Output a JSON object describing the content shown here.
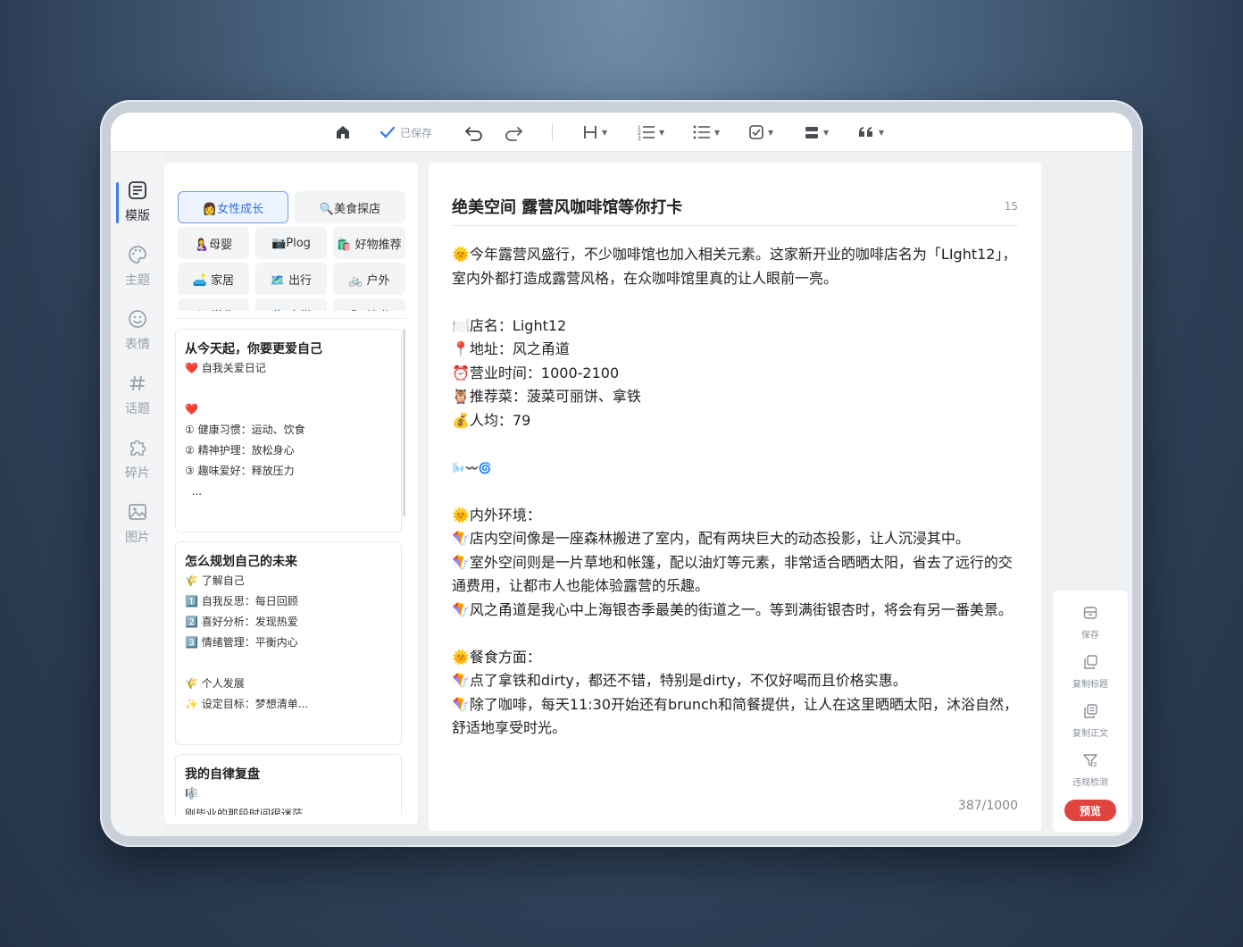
{
  "toolbar": {
    "saved_label": "已保存",
    "icons": [
      "home-icon",
      "check-icon",
      "undo-icon",
      "redo-icon",
      "heading-icon",
      "ordered-list-icon",
      "bullet-list-icon",
      "checkbox-icon",
      "block-icon",
      "quote-icon"
    ]
  },
  "nav": {
    "items": [
      {
        "label": "模版",
        "icon": "template-icon",
        "active": true
      },
      {
        "label": "主题",
        "icon": "palette-icon"
      },
      {
        "label": "表情",
        "icon": "emoji-icon"
      },
      {
        "label": "话题",
        "icon": "hashtag-icon"
      },
      {
        "label": "碎片",
        "icon": "puzzle-icon"
      },
      {
        "label": "图片",
        "icon": "image-icon"
      }
    ]
  },
  "categories": [
    {
      "label": "👩女性成长",
      "active": true
    },
    {
      "label": "🔍美食探店"
    },
    {
      "label": "🤱母婴"
    },
    {
      "label": "📷Plog"
    },
    {
      "label": "🛍️ 好物推荐"
    },
    {
      "label": "🛋️ 家居"
    },
    {
      "label": "🗺️ 出行"
    },
    {
      "label": "🚲 户外"
    },
    {
      "label": "🎓 学业"
    },
    {
      "label": "👗 穿搭"
    },
    {
      "label": "📚 读书"
    }
  ],
  "cards": [
    {
      "title": "从今天起，你要更爱自己",
      "lines": [
        "❤️ 自我关爱日记",
        "",
        "❤️",
        "① 健康习惯：运动、饮食",
        "② 精神护理：放松身心",
        "③ 趣味爱好：释放压力",
        "  ..."
      ]
    },
    {
      "title": "怎么规划自己的未来",
      "lines": [
        "🌾 了解自己",
        "1️⃣ 自我反思：每日回顾",
        "2️⃣ 喜好分析：发现热爱",
        "3️⃣ 情绪管理：平衡内心",
        "",
        "🌾 个人发展",
        "✨ 设定目标：梦想清单..."
      ]
    },
    {
      "title": "我的自律复盘",
      "lines": [
        "🎼",
        "刚毕业的那段时间很迷茫"
      ]
    }
  ],
  "editor": {
    "title": "绝美空间 露营风咖啡馆等你打卡",
    "title_count": "15",
    "paragraphs": [
      "🌞今年露营风盛行，不少咖啡馆也加入相关元素。这家新开业的咖啡店名为「LIght12」，室内外都打造成露营风格，在众咖啡馆里真的让人眼前一亮。",
      "",
      "🍽️店名：Light12",
      "📍地址：风之甬道",
      "⏰营业时间：1000-2100",
      "🦉推荐菜：菠菜可丽饼、拿铁",
      "💰人均：79",
      "",
      "🌬️〰️🌀",
      "",
      "🌞内外环境：",
      "🪁店内空间像是一座森林搬进了室内，配有两块巨大的动态投影，让人沉浸其中。",
      "🪁室外空间则是一片草地和帐篷，配以油灯等元素，非常适合晒晒太阳，省去了远行的交通费用，让都市人也能体验露营的乐趣。",
      "🪁风之甬道是我心中上海银杏季最美的街道之一。等到满街银杏时，将会有另一番美景。",
      "",
      "🌞餐食方面：",
      "🪁点了拿铁和dirty，都还不错，特别是dirty，不仅好喝而且价格实惠。",
      "🪁除了咖啡，每天11:30开始还有brunch和简餐提供，让人在这里晒晒太阳，沐浴自然，舒适地享受时光。"
    ],
    "word_count": "387/1000"
  },
  "right_tools": {
    "save": "保存",
    "copy_title": "复制标题",
    "copy_body": "复制正文",
    "check": "违规检测",
    "preview": "预览"
  },
  "colors": {
    "accent": "#3f7ef0",
    "preview_button": "#e0443f"
  }
}
